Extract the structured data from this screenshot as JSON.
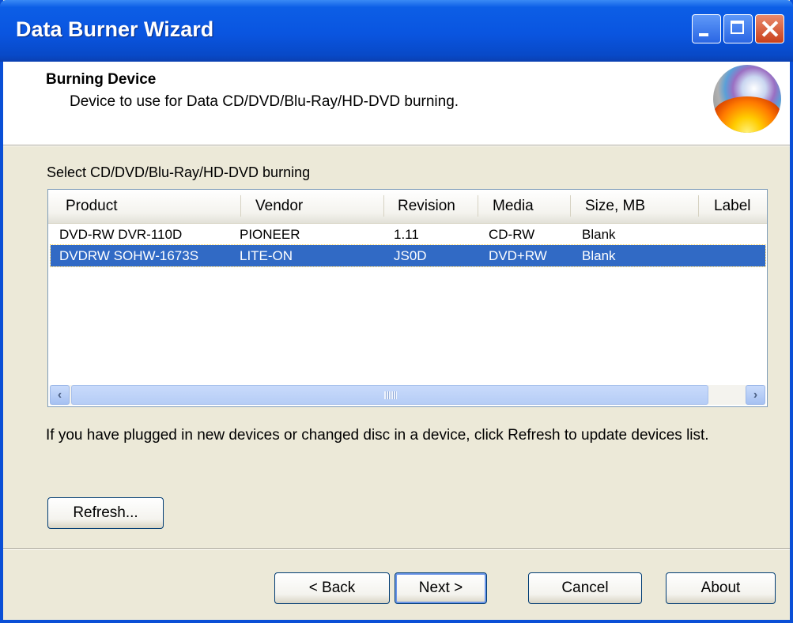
{
  "window": {
    "title": "Data Burner Wizard"
  },
  "header": {
    "title": "Burning Device",
    "subtitle": "Device to use for Data CD/DVD/Blu-Ray/HD-DVD burning."
  },
  "device_list": {
    "label": "Select CD/DVD/Blu-Ray/HD-DVD burning",
    "columns": [
      "Product",
      "Vendor",
      "Revision",
      "Media",
      "Size, MB",
      "Label"
    ],
    "rows": [
      {
        "product": "DVD-RW  DVR-110D",
        "vendor": "PIONEER",
        "revision": "1.11",
        "media": "CD-RW",
        "size": "Blank",
        "label": "",
        "selected": false
      },
      {
        "product": "DVDRW SOHW-1673S",
        "vendor": "LITE-ON",
        "revision": "JS0D",
        "media": "DVD+RW",
        "size": "Blank",
        "label": "",
        "selected": true
      }
    ],
    "selected_row_color": "#316ac5"
  },
  "info_text": "If you have plugged in new devices or changed disc in a device, click Refresh to update devices list.",
  "buttons": {
    "refresh": "Refresh...",
    "back": "< Back",
    "next": "Next >",
    "cancel": "Cancel",
    "about": "About"
  },
  "colors": {
    "titlebar": "#0a55e0",
    "dialog_bg": "#ece9d8",
    "selection": "#316ac5"
  }
}
